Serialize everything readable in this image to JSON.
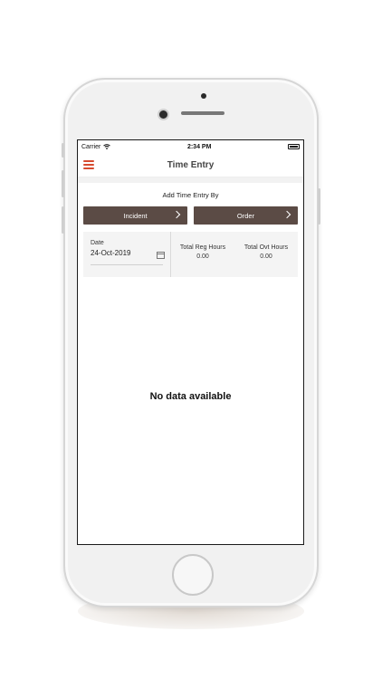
{
  "status_bar": {
    "carrier": "Carrier",
    "time": "2:34 PM"
  },
  "header": {
    "title": "Time Entry"
  },
  "add_entry": {
    "heading": "Add Time Entry By",
    "incident_label": "Incident",
    "order_label": "Order"
  },
  "summary": {
    "date_label": "Date",
    "date_value": "24-Oct-2019",
    "reg_hours_label": "Total Reg Hours",
    "reg_hours_value": "0.00",
    "ovt_hours_label": "Total Ovt Hours",
    "ovt_hours_value": "0.00"
  },
  "empty_state": {
    "message": "No data available"
  },
  "colors": {
    "accent": "#d64a2f",
    "button": "#5b4b45"
  },
  "icons": [
    "wifi-icon",
    "battery-icon",
    "menu-icon",
    "chevron-right-icon",
    "calendar-icon"
  ]
}
